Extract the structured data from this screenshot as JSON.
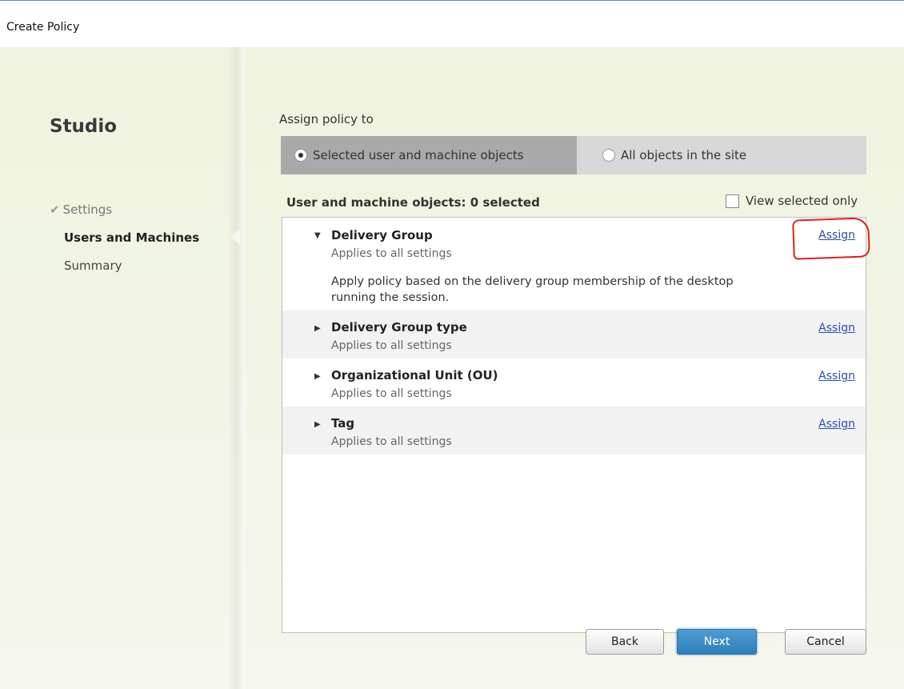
{
  "window": {
    "title": "Create Policy"
  },
  "sidebar": {
    "brand": "Studio",
    "steps": [
      {
        "label": "Settings",
        "state": "done"
      },
      {
        "label": "Users and Machines",
        "state": "current"
      },
      {
        "label": "Summary",
        "state": "pending"
      }
    ]
  },
  "assign_policy": {
    "label": "Assign policy to",
    "options": [
      {
        "label": "Selected user and machine objects",
        "selected": true
      },
      {
        "label": "All objects in the site",
        "selected": false
      }
    ]
  },
  "objects": {
    "count_label": "User and machine objects: 0 selected",
    "view_selected_label": "View selected only",
    "view_selected_checked": false,
    "items": [
      {
        "name": "Delivery Group",
        "subtitle": "Applies to all settings",
        "expanded": true,
        "description": "Apply policy based on the delivery group membership of the desktop running the session.",
        "action": "Assign"
      },
      {
        "name": "Delivery Group type",
        "subtitle": "Applies to all settings",
        "expanded": false,
        "action": "Assign"
      },
      {
        "name": "Organizational Unit (OU)",
        "subtitle": "Applies to all settings",
        "expanded": false,
        "action": "Assign"
      },
      {
        "name": "Tag",
        "subtitle": "Applies to all settings",
        "expanded": false,
        "action": "Assign"
      }
    ]
  },
  "footer": {
    "back_label": "Back",
    "next_label": "Next",
    "cancel_label": "Cancel"
  },
  "colors": {
    "link": "#2a4fb3",
    "primary_button": "#2f7fba",
    "annotation_ring": "#e02020"
  }
}
